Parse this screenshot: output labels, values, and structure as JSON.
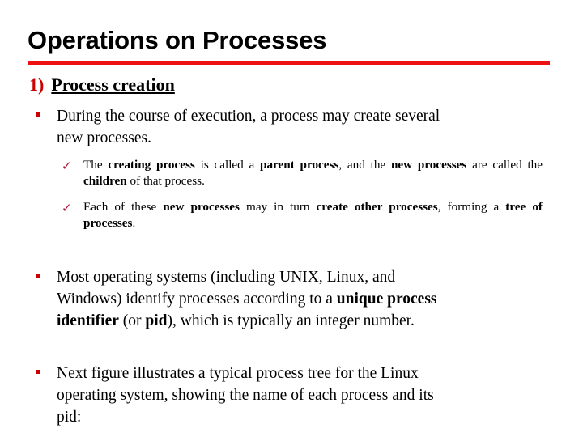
{
  "slide": {
    "title": "Operations on Processes",
    "accent_color": "#ee1111",
    "number_color": "#cc0000",
    "check_color": "#aa1133",
    "background_color": "#ffffff",
    "text_color": "#000000",
    "section": {
      "number": "1)",
      "heading": "Process creation"
    },
    "bullets": [
      {
        "id": "during",
        "marker": "square-bullet",
        "text": "During the course of execution, a process may create several new processes.",
        "line1": "During the course of execution, a process may create several",
        "line2": "new processes."
      },
      {
        "id": "most",
        "marker": "square-bullet",
        "text": "Most operating systems (including UNIX, Linux, and Windows) identify processes according to a unique process identifier (or pid), which is typically an integer number.",
        "line1_plain": "Most operating systems (including UNIX, Linux, and",
        "line2_pre": "Windows) identify processes according to a ",
        "line2_bold": "unique process",
        "line3_bold_a": "identifier",
        "line3_mid": " (or ",
        "line3_bold_b": "pid",
        "line3_tail": "), which is typically an integer number."
      },
      {
        "id": "next",
        "marker": "square-bullet",
        "text": "Next figure illustrates a typical process tree for the Linux operating system, showing the name of each process and its pid:",
        "line1": "Next figure illustrates a typical process tree for the Linux",
        "line2": "operating system, showing the name of each process and its",
        "line3": "pid:"
      }
    ],
    "sub_bullets": [
      {
        "id": "creating",
        "marker": "check-mark",
        "marker_glyph": "✓",
        "text": "The creating process is called a parent process, and the new processes are called the children of that process.",
        "seg1": "The ",
        "seg2_bold": "creating process",
        "seg3": " is called a ",
        "seg4_bold": "parent process",
        "seg5": ", and the ",
        "seg6_bold": "new processes",
        "seg7": " are called the ",
        "seg8_bold": "children",
        "seg9": " of that process."
      },
      {
        "id": "each",
        "marker": "check-mark",
        "marker_glyph": "✓",
        "text": "Each of these new processes may in turn create other processes, forming a tree of processes.",
        "seg1": "Each of these ",
        "seg2_bold": "new processes",
        "seg3": " may in turn ",
        "seg4_bold": "create other processes",
        "seg5": ", forming a ",
        "seg6_bold": "tree of processes",
        "seg7": "."
      }
    ]
  }
}
